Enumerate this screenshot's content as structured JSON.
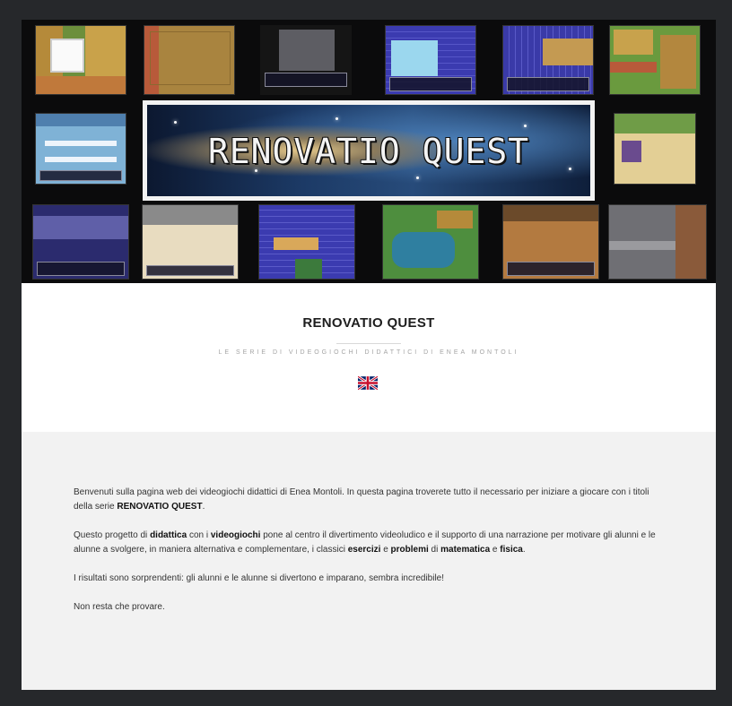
{
  "hero": {
    "banner_title": "RENOVATIO QUEST"
  },
  "header": {
    "title": "RENOVATIO QUEST",
    "subtitle": "LE SERIE DI VIDEOGIOCHI DIDATTICI DI ENEA MONTOLI",
    "language_flag_icon": "uk-flag-icon"
  },
  "intro": {
    "p1_text": "Benvenuti sulla pagina web dei videogiochi didattici di Enea Montoli. In questa pagina troverete tutto il necessario per iniziare a giocare con i titoli della serie ",
    "p1_bold": "RENOVATIO QUEST",
    "p1_end": ".",
    "p2_a": "Questo progetto di ",
    "p2_b1": "didattica",
    "p2_c": " con i ",
    "p2_b2": "videogiochi",
    "p2_d": " pone al centro il divertimento videoludico e il supporto di una narrazione per motivare gli alunni e le alunne a svolgere, in maniera alternativa e complementare, i classici ",
    "p2_b3": "esercizi",
    "p2_e": " e ",
    "p2_b4": "problemi",
    "p2_f": " di ",
    "p2_b5": "matematica",
    "p2_g": " e ",
    "p2_b6": "fisica",
    "p2_h": ".",
    "p3": "I risultati sono sorprendenti: gli alunni e le alunne si divertono e imparano, sembra incredibile!",
    "p4": "Non resta che provare."
  },
  "colors": {
    "page_bg": "#26282b",
    "hero_bg": "#0b0b0c",
    "title_bg": "#ffffff",
    "content_bg": "#f2f2f2"
  }
}
